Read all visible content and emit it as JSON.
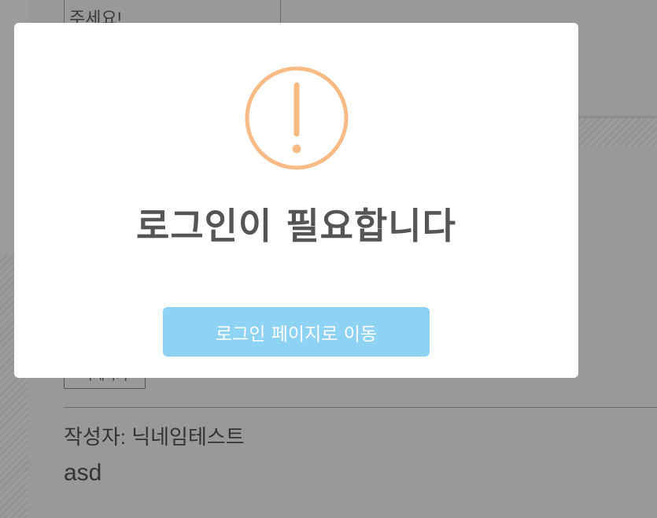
{
  "background": {
    "textbox_text": "주세요!",
    "delete_button_label": "삭제하기",
    "author_text": "작성자: 닉네임테스트",
    "comment_text": "asd"
  },
  "modal": {
    "icon": "warning-circle-icon",
    "title": "로그인이 필요합니다",
    "button_label": "로그인 페이지로 이동",
    "colors": {
      "icon": "#f8bb86",
      "button": "#8fd3f4",
      "title": "#555555"
    }
  }
}
